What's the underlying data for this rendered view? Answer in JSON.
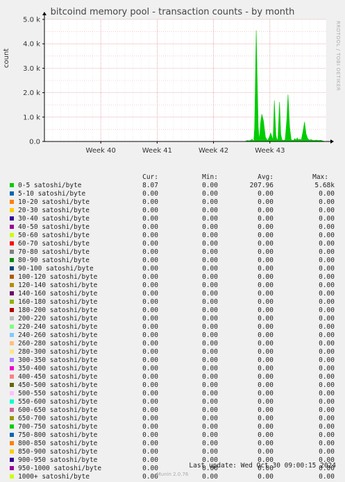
{
  "title": "bitcoind memory pool - transaction counts - by month",
  "watermark": "RRDTOOL / TOBI OETIKER",
  "footer": "Munin 2.0.76",
  "last_update": "Last update: Wed Oct 30 09:00:15 2024",
  "legend_headers": {
    "cur": "Cur:",
    "min": "Min:",
    "avg": "Avg:",
    "max": "Max:"
  },
  "chart_data": {
    "type": "area",
    "title": "bitcoind memory pool - transaction counts - by month",
    "ylabel": "count",
    "ylim": [
      0,
      5000
    ],
    "y_ticks": [
      {
        "value": 0,
        "label": "0.0"
      },
      {
        "value": 1000,
        "label": "1.0 k"
      },
      {
        "value": 2000,
        "label": "2.0 k"
      },
      {
        "value": 3000,
        "label": "3.0 k"
      },
      {
        "value": 4000,
        "label": "4.0 k"
      },
      {
        "value": 5000,
        "label": "5.0 k"
      }
    ],
    "x_range": [
      0,
      35
    ],
    "x_ticks": [
      {
        "value": 7,
        "label": "Week 40"
      },
      {
        "value": 14,
        "label": "Week 41"
      },
      {
        "value": 21,
        "label": "Week 42"
      },
      {
        "value": 28,
        "label": "Week 43"
      }
    ],
    "grid": true,
    "series": [
      {
        "name": "0-5 satoshi/byte",
        "color": "#00cc00",
        "points": [
          [
            24.9,
            0
          ],
          [
            25.2,
            40
          ],
          [
            25.5,
            30
          ],
          [
            25.8,
            90
          ],
          [
            26.0,
            0
          ],
          [
            26.1,
            600
          ],
          [
            26.3,
            4550
          ],
          [
            26.55,
            600
          ],
          [
            26.7,
            60
          ],
          [
            26.85,
            800
          ],
          [
            27.0,
            1120
          ],
          [
            27.2,
            850
          ],
          [
            27.45,
            180
          ],
          [
            27.7,
            40
          ],
          [
            27.9,
            150
          ],
          [
            28.1,
            350
          ],
          [
            28.3,
            150
          ],
          [
            28.4,
            60
          ],
          [
            28.55,
            1680
          ],
          [
            28.75,
            250
          ],
          [
            28.9,
            60
          ],
          [
            29.0,
            120
          ],
          [
            29.2,
            1620
          ],
          [
            29.35,
            300
          ],
          [
            29.5,
            70
          ],
          [
            29.7,
            40
          ],
          [
            29.9,
            80
          ],
          [
            30.1,
            900
          ],
          [
            30.25,
            1920
          ],
          [
            30.45,
            600
          ],
          [
            30.65,
            70
          ],
          [
            30.9,
            40
          ],
          [
            31.1,
            120
          ],
          [
            31.25,
            60
          ],
          [
            31.4,
            150
          ],
          [
            31.55,
            60
          ],
          [
            31.7,
            100
          ],
          [
            31.9,
            60
          ],
          [
            32.1,
            400
          ],
          [
            32.3,
            800
          ],
          [
            32.5,
            300
          ],
          [
            32.7,
            120
          ],
          [
            32.9,
            60
          ],
          [
            33.1,
            80
          ],
          [
            33.3,
            50
          ],
          [
            33.5,
            40
          ],
          [
            33.8,
            60
          ],
          [
            34.0,
            40
          ],
          [
            34.3,
            50
          ],
          [
            34.6,
            20
          ],
          [
            34.9,
            0
          ]
        ]
      }
    ]
  },
  "legend": [
    {
      "label": "0-5 satoshi/byte",
      "color": "#00cc00",
      "cur": "8.07",
      "min": "0.00",
      "avg": "207.96",
      "max": "5.68k"
    },
    {
      "label": "5-10 satoshi/byte",
      "color": "#0066b3",
      "cur": "0.00",
      "min": "0.00",
      "avg": "0.00",
      "max": "0.00"
    },
    {
      "label": "10-20 satoshi/byte",
      "color": "#ff8000",
      "cur": "0.00",
      "min": "0.00",
      "avg": "0.00",
      "max": "0.00"
    },
    {
      "label": "20-30 satoshi/byte",
      "color": "#ffcc00",
      "cur": "0.00",
      "min": "0.00",
      "avg": "0.00",
      "max": "0.00"
    },
    {
      "label": "30-40 satoshi/byte",
      "color": "#330099",
      "cur": "0.00",
      "min": "0.00",
      "avg": "0.00",
      "max": "0.00"
    },
    {
      "label": "40-50 satoshi/byte",
      "color": "#990099",
      "cur": "0.00",
      "min": "0.00",
      "avg": "0.00",
      "max": "0.00"
    },
    {
      "label": "50-60 satoshi/byte",
      "color": "#ccff00",
      "cur": "0.00",
      "min": "0.00",
      "avg": "0.00",
      "max": "0.00"
    },
    {
      "label": "60-70 satoshi/byte",
      "color": "#ff0000",
      "cur": "0.00",
      "min": "0.00",
      "avg": "0.00",
      "max": "0.00"
    },
    {
      "label": "70-80 satoshi/byte",
      "color": "#808080",
      "cur": "0.00",
      "min": "0.00",
      "avg": "0.00",
      "max": "0.00"
    },
    {
      "label": "80-90 satoshi/byte",
      "color": "#008f00",
      "cur": "0.00",
      "min": "0.00",
      "avg": "0.00",
      "max": "0.00"
    },
    {
      "label": "90-100 satoshi/byte",
      "color": "#00487d",
      "cur": "0.00",
      "min": "0.00",
      "avg": "0.00",
      "max": "0.00"
    },
    {
      "label": "100-120 satoshi/byte",
      "color": "#b35a00",
      "cur": "0.00",
      "min": "0.00",
      "avg": "0.00",
      "max": "0.00"
    },
    {
      "label": "120-140 satoshi/byte",
      "color": "#b38f00",
      "cur": "0.00",
      "min": "0.00",
      "avg": "0.00",
      "max": "0.00"
    },
    {
      "label": "140-160 satoshi/byte",
      "color": "#6b006b",
      "cur": "0.00",
      "min": "0.00",
      "avg": "0.00",
      "max": "0.00"
    },
    {
      "label": "160-180 satoshi/byte",
      "color": "#8fb300",
      "cur": "0.00",
      "min": "0.00",
      "avg": "0.00",
      "max": "0.00"
    },
    {
      "label": "180-200 satoshi/byte",
      "color": "#b30000",
      "cur": "0.00",
      "min": "0.00",
      "avg": "0.00",
      "max": "0.00"
    },
    {
      "label": "200-220 satoshi/byte",
      "color": "#bebebe",
      "cur": "0.00",
      "min": "0.00",
      "avg": "0.00",
      "max": "0.00"
    },
    {
      "label": "220-240 satoshi/byte",
      "color": "#80ff80",
      "cur": "0.00",
      "min": "0.00",
      "avg": "0.00",
      "max": "0.00"
    },
    {
      "label": "240-260 satoshi/byte",
      "color": "#80c9ff",
      "cur": "0.00",
      "min": "0.00",
      "avg": "0.00",
      "max": "0.00"
    },
    {
      "label": "260-280 satoshi/byte",
      "color": "#ffc080",
      "cur": "0.00",
      "min": "0.00",
      "avg": "0.00",
      "max": "0.00"
    },
    {
      "label": "280-300 satoshi/byte",
      "color": "#ffe680",
      "cur": "0.00",
      "min": "0.00",
      "avg": "0.00",
      "max": "0.00"
    },
    {
      "label": "300-350 satoshi/byte",
      "color": "#aa80ff",
      "cur": "0.00",
      "min": "0.00",
      "avg": "0.00",
      "max": "0.00"
    },
    {
      "label": "350-400 satoshi/byte",
      "color": "#ee00cc",
      "cur": "0.00",
      "min": "0.00",
      "avg": "0.00",
      "max": "0.00"
    },
    {
      "label": "400-450 satoshi/byte",
      "color": "#ff8080",
      "cur": "0.00",
      "min": "0.00",
      "avg": "0.00",
      "max": "0.00"
    },
    {
      "label": "450-500 satoshi/byte",
      "color": "#666600",
      "cur": "0.00",
      "min": "0.00",
      "avg": "0.00",
      "max": "0.00"
    },
    {
      "label": "500-550 satoshi/byte",
      "color": "#ffbfff",
      "cur": "0.00",
      "min": "0.00",
      "avg": "0.00",
      "max": "0.00"
    },
    {
      "label": "550-600 satoshi/byte",
      "color": "#00ffcc",
      "cur": "0.00",
      "min": "0.00",
      "avg": "0.00",
      "max": "0.00"
    },
    {
      "label": "600-650 satoshi/byte",
      "color": "#cc6699",
      "cur": "0.00",
      "min": "0.00",
      "avg": "0.00",
      "max": "0.00"
    },
    {
      "label": "650-700 satoshi/byte",
      "color": "#999900",
      "cur": "0.00",
      "min": "0.00",
      "avg": "0.00",
      "max": "0.00"
    },
    {
      "label": "700-750 satoshi/byte",
      "color": "#00cc00",
      "cur": "0.00",
      "min": "0.00",
      "avg": "0.00",
      "max": "0.00"
    },
    {
      "label": "750-800 satoshi/byte",
      "color": "#0066b3",
      "cur": "0.00",
      "min": "0.00",
      "avg": "0.00",
      "max": "0.00"
    },
    {
      "label": "800-850 satoshi/byte",
      "color": "#ff8000",
      "cur": "0.00",
      "min": "0.00",
      "avg": "0.00",
      "max": "0.00"
    },
    {
      "label": "850-900 satoshi/byte",
      "color": "#ffcc00",
      "cur": "0.00",
      "min": "0.00",
      "avg": "0.00",
      "max": "0.00"
    },
    {
      "label": "900-950 satoshi/byte",
      "color": "#330099",
      "cur": "0.00",
      "min": "0.00",
      "avg": "0.00",
      "max": "0.00"
    },
    {
      "label": "950-1000 satoshi/byte",
      "color": "#990099",
      "cur": "0.00",
      "min": "0.00",
      "avg": "0.00",
      "max": "0.00"
    },
    {
      "label": "1000+ satoshi/byte",
      "color": "#ccff00",
      "cur": "0.00",
      "min": "0.00",
      "avg": "0.00",
      "max": "0.00"
    }
  ]
}
